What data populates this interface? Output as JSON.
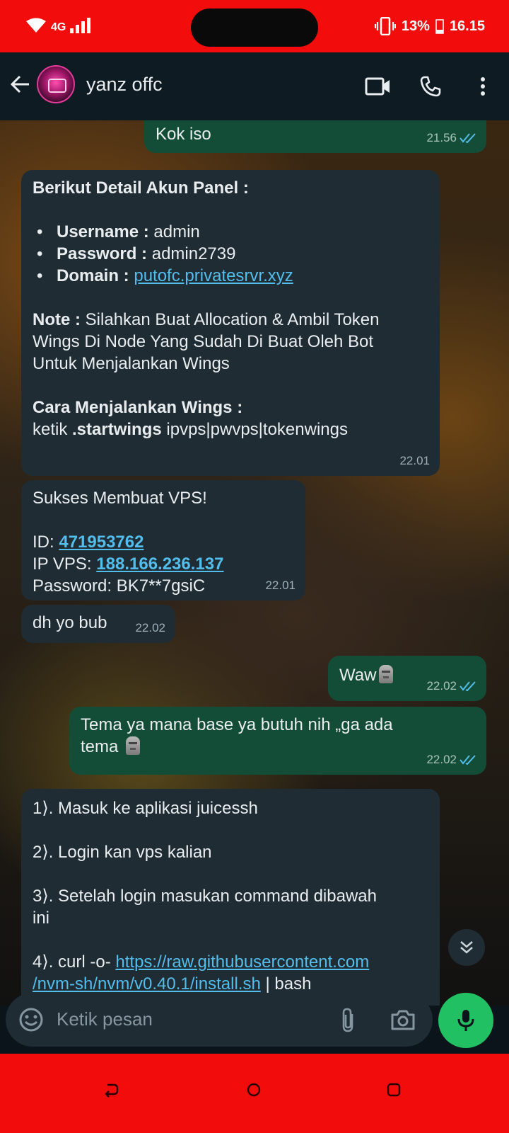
{
  "status_bar": {
    "network": "4G",
    "battery": "13%",
    "clock": "16.15",
    "colors": {
      "bar": "#f20c0c"
    }
  },
  "header": {
    "contact_name": "yanz offc"
  },
  "messages": [
    {
      "dir": "out",
      "text": "Kok iso",
      "time": "21.56"
    },
    {
      "dir": "in",
      "heading": "Berikut Detail Akun Panel :",
      "details": [
        {
          "label": "Username :",
          "value": "admin"
        },
        {
          "label": "Password :",
          "value": "admin2739"
        },
        {
          "label": "Domain :",
          "value": "putofc.privatesrvr.xyz"
        }
      ],
      "note_label": "Note :",
      "note_lines": [
        " Silahkan Buat Allocation & Ambil Token",
        "Wings Di Node Yang Sudah Di Buat Oleh Bot",
        "Untuk Menjalankan Wings"
      ],
      "how_label": "Cara Menjalankan Wings :",
      "how_prefix": "ketik ",
      "how_command": ".startwings",
      "how_args": " ipvps|pwvps|tokenwings",
      "time": "22.01"
    },
    {
      "dir": "in",
      "line1": "Sukses Membuat VPS!",
      "id_label": "ID: ",
      "id_value": "471953762",
      "ip_label": "IP VPS: ",
      "ip_value": "188.166.236.137",
      "pw_label": "Password: ",
      "pw_value": "BK7**7gsiC",
      "time": "22.01"
    },
    {
      "dir": "in",
      "text": "dh yo bub",
      "time": "22.02"
    },
    {
      "dir": "out",
      "text": "Waw",
      "time": "22.02"
    },
    {
      "dir": "out",
      "text_line1": "Tema ya mana base ya butuh nih „ga ada",
      "text_line2": "tema",
      "time": "22.02"
    },
    {
      "dir": "in",
      "step1": "1⟩. Masuk ke aplikasi juicessh",
      "step2": "2⟩. Login kan vps kalian",
      "step3_line1": "3⟩. Setelah login masukan command dibawah",
      "step3_line2": "ini",
      "step4_prefix": "4⟩. curl -o- ",
      "step4_link1": "https://raw.githubusercontent.com",
      "step4_link2": "/nvm-sh/nvm/v0.40.1/install.sh",
      "step4_suffix": " | bash"
    }
  ],
  "composer": {
    "placeholder": "Ketik pesan"
  },
  "colors": {
    "accent_green": "#21c063",
    "bubble_in": "#1f2c34",
    "bubble_out": "#144d37",
    "link": "#53bdeb",
    "read_tick": "#53bdeb"
  }
}
